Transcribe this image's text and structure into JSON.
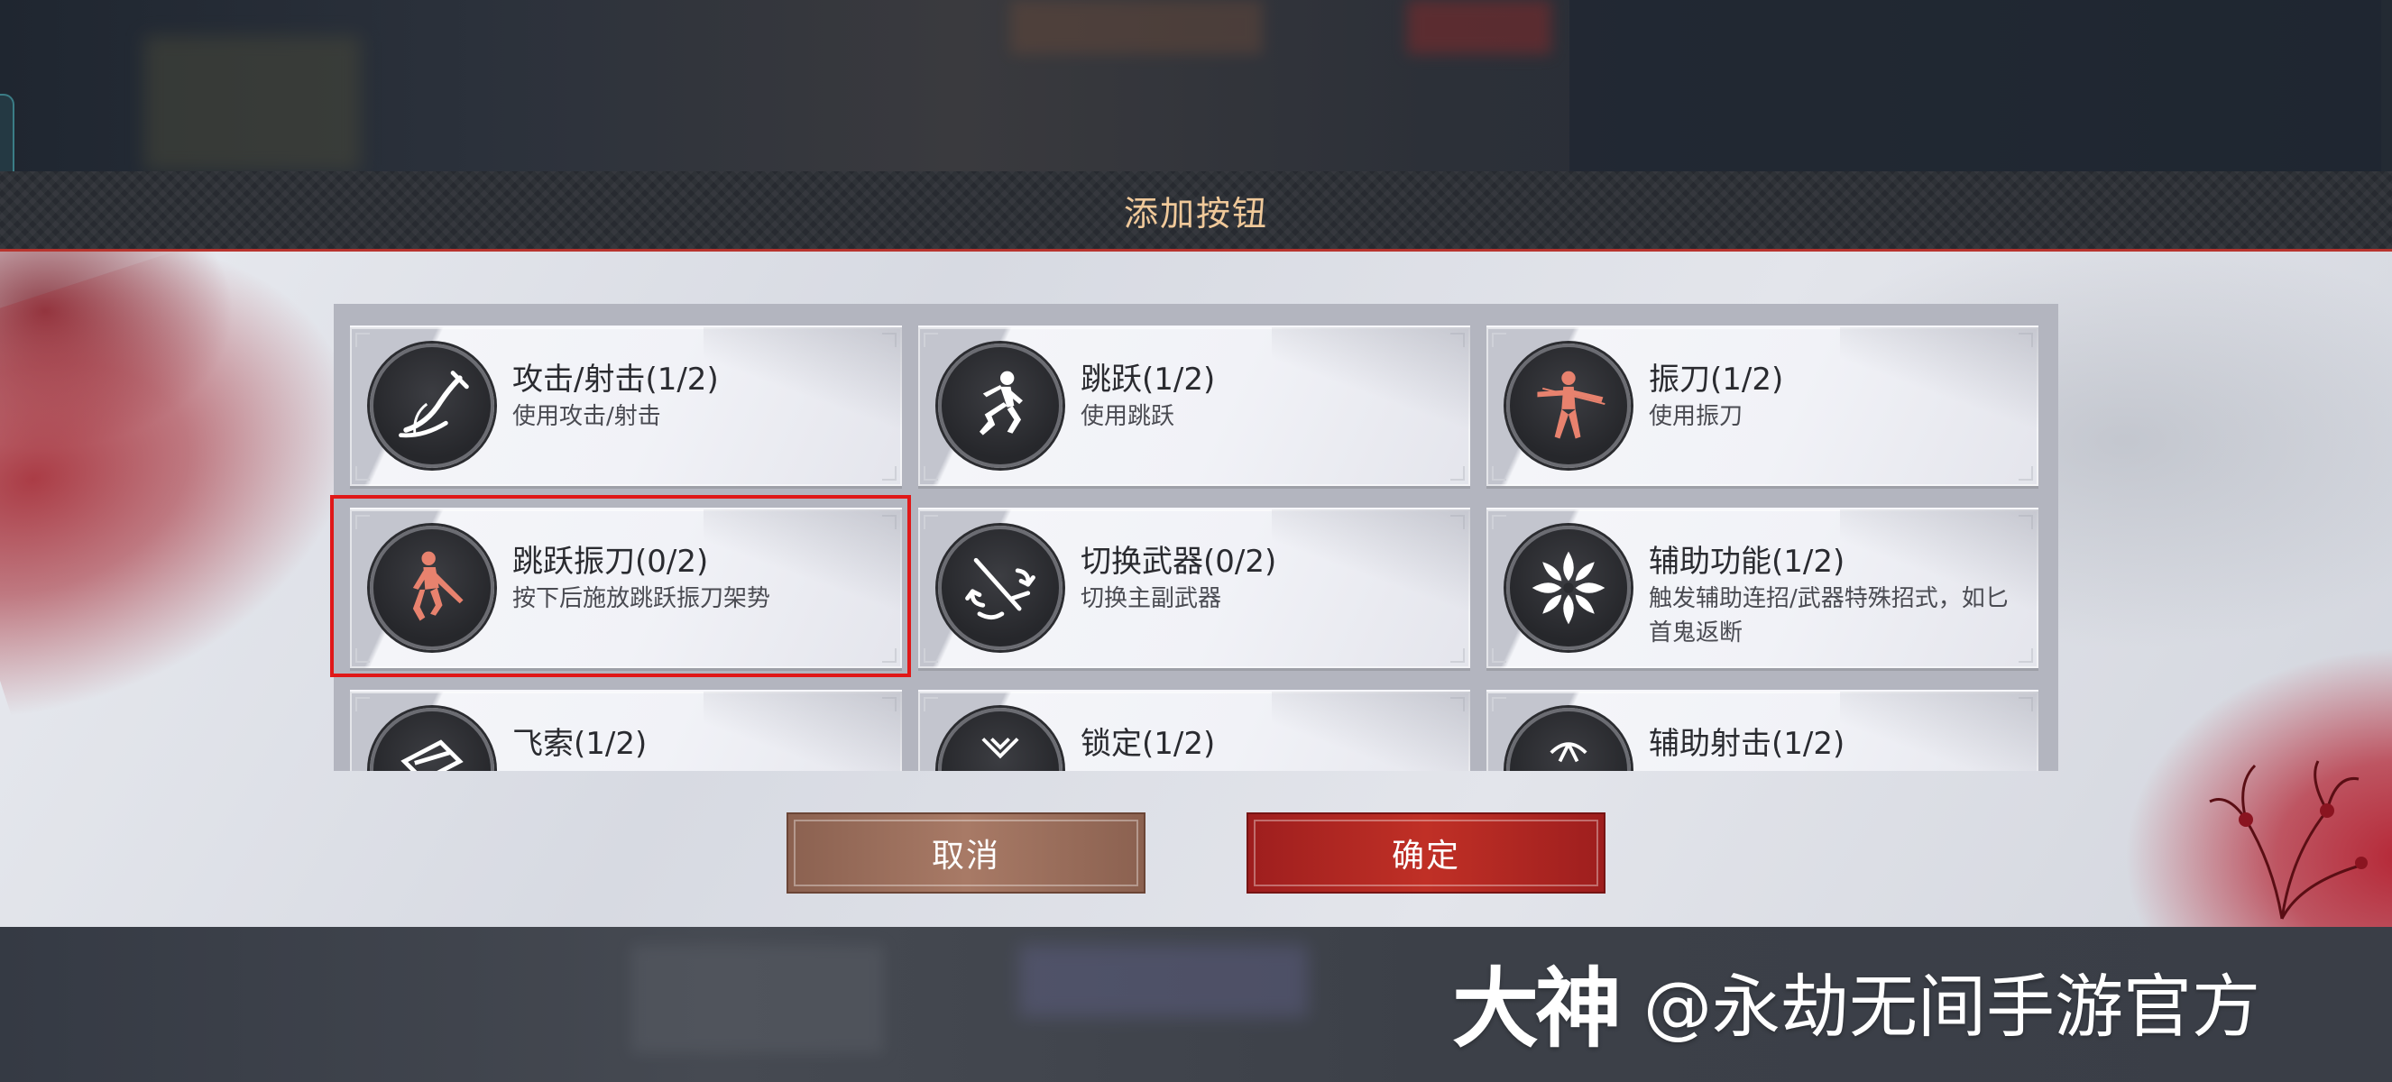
{
  "dialog": {
    "title": "添加按钮"
  },
  "buttons_list": [
    {
      "name": "攻击/射击(1/2)",
      "desc": "使用攻击/射击",
      "icon": "sword-slash-icon",
      "icon_color": "#ffffff"
    },
    {
      "name": "跳跃(1/2)",
      "desc": "使用跳跃",
      "icon": "jump-figure-icon",
      "icon_color": "#ffffff"
    },
    {
      "name": "振刀(1/2)",
      "desc": "使用振刀",
      "icon": "parry-figure-icon",
      "icon_color": "#e8826e"
    },
    {
      "name": "跳跃振刀(0/2)",
      "desc": "按下后施放跳跃振刀架势",
      "icon": "jump-parry-figure-icon",
      "icon_color": "#e8826e"
    },
    {
      "name": "切换武器(0/2)",
      "desc": "切换主副武器",
      "icon": "switch-weapon-icon",
      "icon_color": "#ffffff"
    },
    {
      "name": "辅助功能(1/2)",
      "desc": "触发辅助连招/武器特殊招式，如匕首鬼返断",
      "icon": "flower-emblem-icon",
      "icon_color": "#ffffff"
    },
    {
      "name": "飞索(1/2)",
      "desc": "",
      "icon": "grapple-icon",
      "icon_color": "#ffffff"
    },
    {
      "name": "锁定(1/2)",
      "desc": "",
      "icon": "lock-on-icon",
      "icon_color": "#ffffff"
    },
    {
      "name": "辅助射击(1/2)",
      "desc": "",
      "icon": "aim-assist-icon",
      "icon_color": "#ffffff"
    }
  ],
  "actions": {
    "cancel_label": "取消",
    "confirm_label": "确定"
  },
  "watermark": {
    "logo": "大神",
    "handle": "@永劫无间手游官方"
  },
  "colors": {
    "title_text": "#f0c99a",
    "accent_red": "#b8342e",
    "highlight": "#e01818",
    "confirm_bg": "#c03026",
    "cancel_bg": "#a87a66"
  }
}
